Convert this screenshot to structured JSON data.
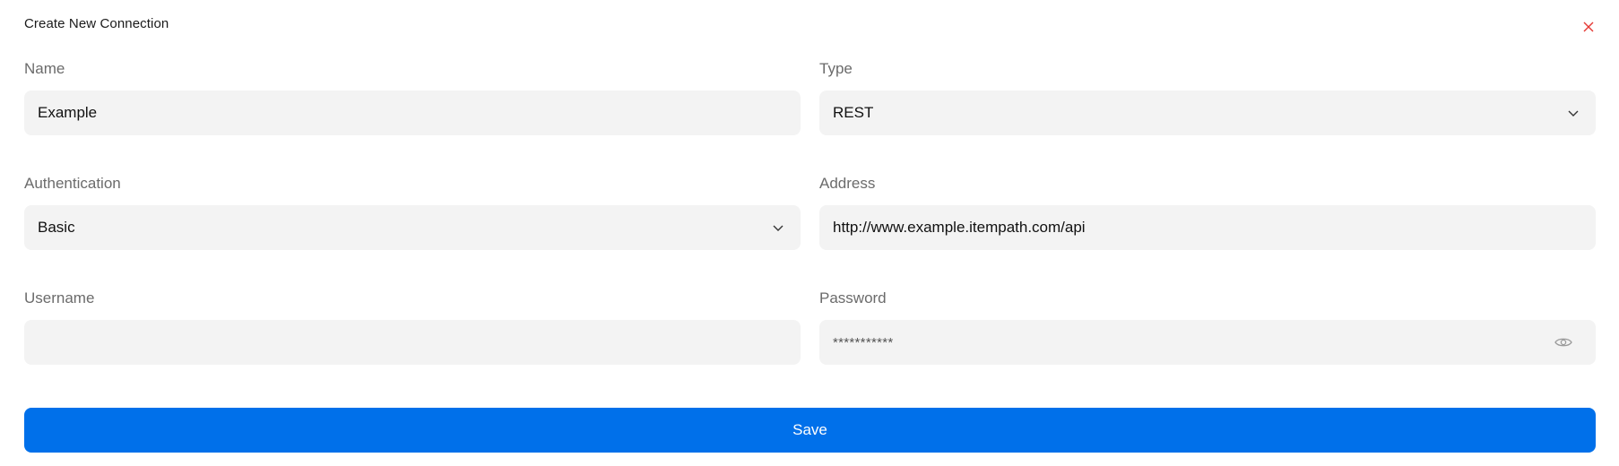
{
  "dialog": {
    "title": "Create New Connection",
    "close_icon": "close-icon",
    "close_color": "#e53935"
  },
  "form": {
    "name": {
      "label": "Name",
      "value": "Example"
    },
    "type": {
      "label": "Type",
      "value": "REST",
      "icon": "chevron-down-icon"
    },
    "authentication": {
      "label": "Authentication",
      "value": "Basic",
      "icon": "chevron-down-icon"
    },
    "address": {
      "label": "Address",
      "value": "http://www.example.itempath.com/api"
    },
    "username": {
      "label": "Username",
      "value": ""
    },
    "password": {
      "label": "Password",
      "masked_value": "***********",
      "icon": "eye-icon"
    }
  },
  "actions": {
    "save_label": "Save",
    "save_color": "#0070ea"
  }
}
